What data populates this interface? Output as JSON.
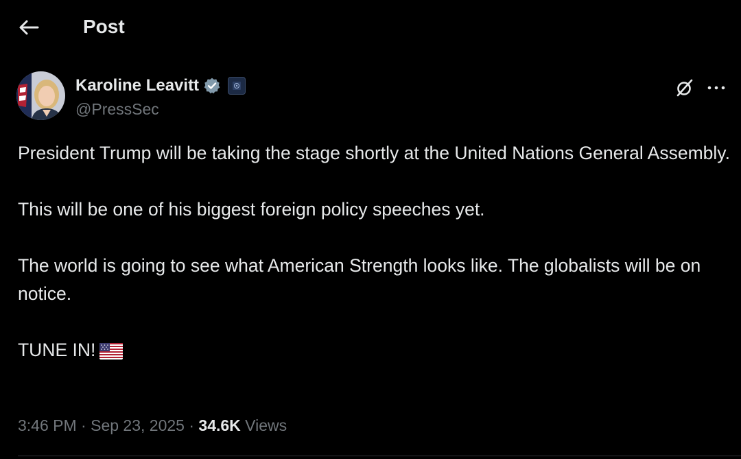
{
  "header": {
    "title": "Post",
    "back_icon": "arrow-left-icon"
  },
  "author": {
    "display_name": "Karoline Leavitt",
    "handle": "@PressSec",
    "verified_color": "#829aab",
    "affiliation_icon": "government-seal-icon"
  },
  "actions": {
    "grok_icon": "grok-icon",
    "more_icon": "more-dots-icon"
  },
  "post": {
    "paragraphs": [
      "President Trump will be taking the stage shortly at the United Nations General Assembly.",
      "This will be one of his biggest foreign policy speeches yet.",
      "The world is going to see what American Strength looks like. The globalists will be on notice.",
      "TUNE IN!"
    ],
    "emoji": "us-flag-emoji"
  },
  "meta": {
    "time": "3:46 PM",
    "separator": "·",
    "date": "Sep 23, 2025",
    "views_count": "34.6K",
    "views_label": "Views"
  },
  "colors": {
    "background": "#000000",
    "text_primary": "#e7e9ea",
    "text_secondary": "#71767b"
  }
}
